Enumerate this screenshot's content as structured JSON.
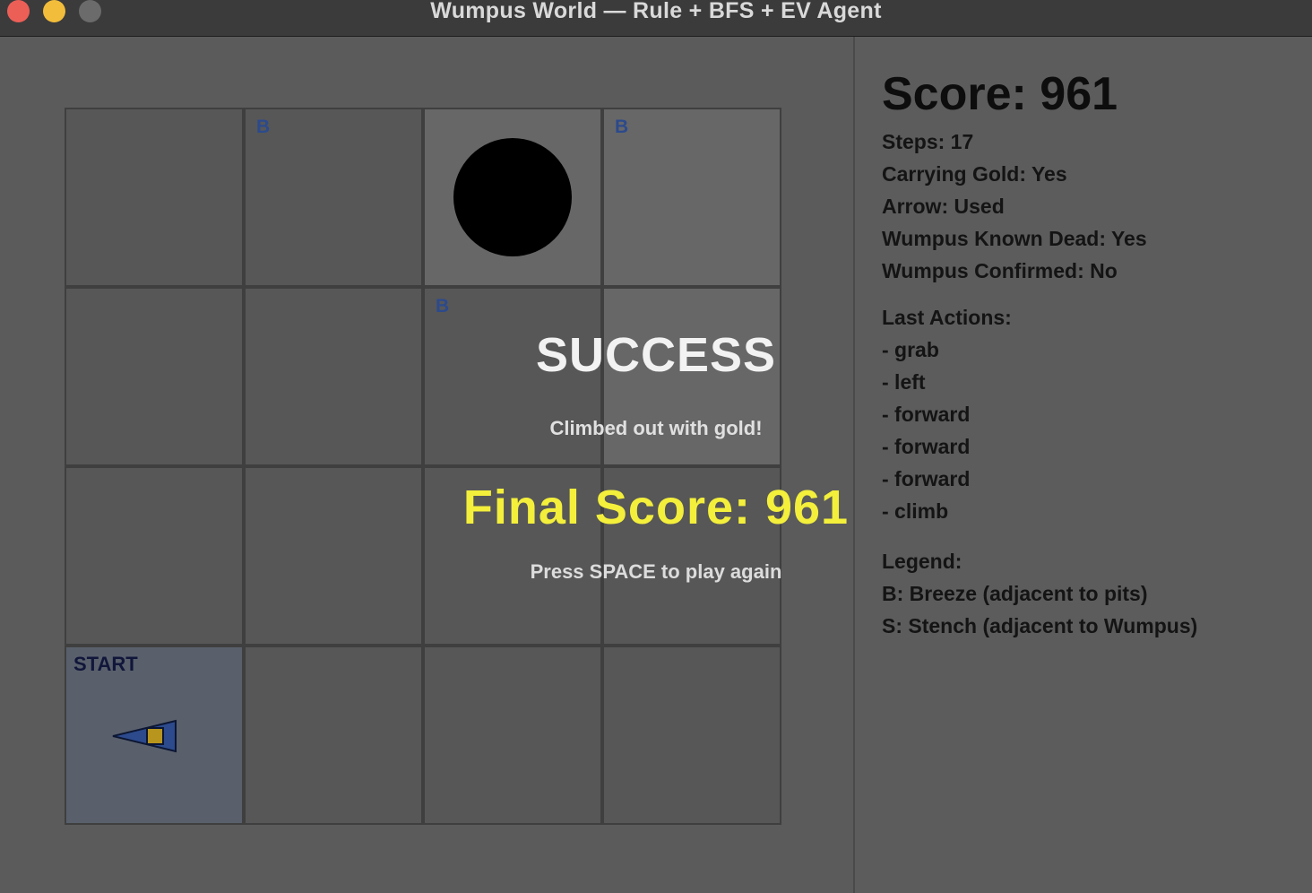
{
  "window": {
    "title": "Wumpus World — Rule + BFS + EV Agent"
  },
  "colors": {
    "background": "#5b5b5b",
    "titlebar": "#3b3b3b",
    "close": "#ec5f57",
    "minimize": "#f2bd3a",
    "maximize": "#6b6b6b",
    "breeze_label": "#2c4a8c",
    "final_score": "#f3ef3b",
    "pit": "#000000",
    "agent_body": "#2c4a8c",
    "agent_gold": "#b8961e"
  },
  "grid": {
    "rows": 4,
    "cols": 4,
    "cells": [
      {
        "row": 0,
        "col": 0,
        "label": "",
        "pit": false,
        "visited": false
      },
      {
        "row": 0,
        "col": 1,
        "label": "B",
        "pit": false,
        "visited": false
      },
      {
        "row": 0,
        "col": 2,
        "label": "",
        "pit": true,
        "visited": true
      },
      {
        "row": 0,
        "col": 3,
        "label": "B",
        "pit": false,
        "visited": true
      },
      {
        "row": 1,
        "col": 2,
        "label": "B",
        "pit": false,
        "visited": false
      },
      {
        "row": 3,
        "col": 0,
        "label": "START",
        "start": true
      }
    ],
    "start_label": "START",
    "breeze_label": "B",
    "agent_facing": "left",
    "agent_carrying_gold": true
  },
  "overlay": {
    "title": "SUCCESS",
    "subtitle": "Climbed out with gold!",
    "final_score": "Final Score: 961",
    "prompt": "Press SPACE to play again"
  },
  "panel": {
    "score": "Score: 961",
    "steps": "Steps: 17",
    "carrying_gold": "Carrying Gold: Yes",
    "arrow": "Arrow: Used",
    "wumpus_known_dead": "Wumpus Known Dead: Yes",
    "wumpus_confirmed": "Wumpus Confirmed: No",
    "last_actions_heading": "Last Actions:",
    "last_actions": [
      "- grab",
      "- left",
      "- forward",
      "- forward",
      "- forward",
      "- climb"
    ],
    "legend_heading": "Legend:",
    "legend": [
      "B: Breeze (adjacent to pits)",
      "S: Stench (adjacent to Wumpus)"
    ]
  }
}
